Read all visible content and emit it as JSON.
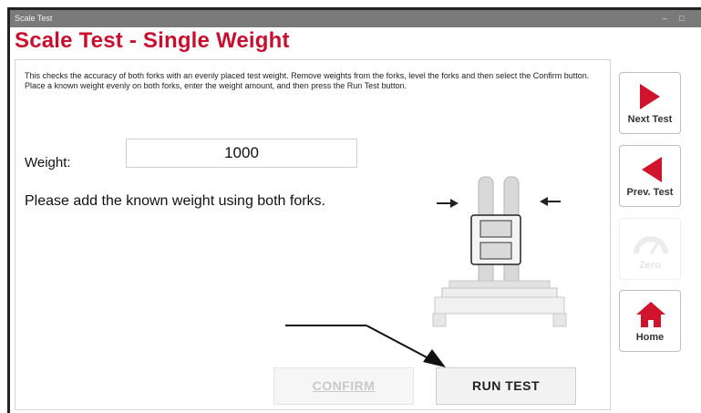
{
  "window": {
    "title": "Scale Test",
    "controls": {
      "minimize": "–",
      "maximize": "□"
    }
  },
  "page": {
    "title": "Scale Test - Single Weight",
    "instructions": "This checks the accuracy of both forks with an evenly placed test weight. Remove weights from the forks, level the forks and then select the Confirm button. Place a known weight evenly on both forks, enter the weight amount, and then press the Run Test button."
  },
  "form": {
    "weight_label": "Weight:",
    "weight_value": "1000",
    "prompt": "Please add the known weight using both forks."
  },
  "buttons": {
    "confirm": "CONFIRM",
    "run_test": "RUN TEST"
  },
  "sidebar": {
    "next_test": "Next Test",
    "prev_test": "Prev. Test",
    "zero": "Zero",
    "home": "Home"
  },
  "colors": {
    "accent": "#c8102e",
    "titlebar": "#7a7a7a"
  },
  "icons": {
    "next_test": "play-right-icon",
    "prev_test": "play-left-icon",
    "zero": "gauge-icon",
    "home": "home-icon"
  }
}
